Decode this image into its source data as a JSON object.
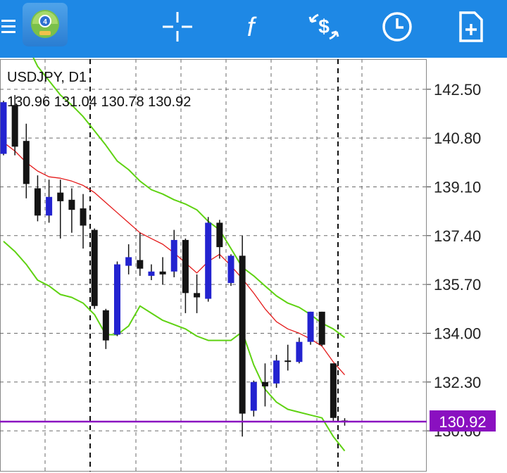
{
  "toolbar": {
    "icons": [
      "menu-icon",
      "app-logo",
      "crosshair-icon",
      "function-icon",
      "trade-icon",
      "clock-icon",
      "add-chart-icon"
    ]
  },
  "colors": {
    "toolbar_bg": "#1e88e5",
    "bull_candle": "#2323d0",
    "bear_candle": "#141414",
    "ma": "#e41a1a",
    "bands": "#5fd212",
    "price_line": "#8a10c0",
    "grid": "#6a6a6a"
  },
  "chart_data": {
    "type": "candlestick",
    "symbol": "USDJPY, D1",
    "ohlc_header": [
      "130.96",
      "131.04",
      "130.78",
      "130.92"
    ],
    "current_price": "130.92",
    "yticks": [
      "142.50",
      "140.80",
      "139.10",
      "137.40",
      "135.70",
      "134.00",
      "132.30",
      "130.60"
    ],
    "ylim": [
      129.18,
      143.55
    ],
    "candles": [
      {
        "o": 140.25,
        "h": 142.1,
        "l": 140.2,
        "c": 142.05
      },
      {
        "o": 141.95,
        "h": 142.3,
        "l": 140.2,
        "c": 140.5
      },
      {
        "o": 140.7,
        "h": 141.3,
        "l": 138.7,
        "c": 139.2
      },
      {
        "o": 139.05,
        "h": 139.5,
        "l": 137.9,
        "c": 138.1
      },
      {
        "o": 138.1,
        "h": 139.35,
        "l": 137.85,
        "c": 138.75
      },
      {
        "o": 138.9,
        "h": 139.35,
        "l": 137.3,
        "c": 138.6
      },
      {
        "o": 138.65,
        "h": 139.05,
        "l": 137.5,
        "c": 138.3
      },
      {
        "o": 138.35,
        "h": 138.85,
        "l": 136.95,
        "c": 137.75
      },
      {
        "o": 137.6,
        "h": 137.65,
        "l": 134.85,
        "c": 134.95
      },
      {
        "o": 134.8,
        "h": 134.85,
        "l": 133.45,
        "c": 133.75
      },
      {
        "o": 133.95,
        "h": 136.5,
        "l": 133.9,
        "c": 136.4
      },
      {
        "o": 136.35,
        "h": 137.1,
        "l": 136.05,
        "c": 136.65
      },
      {
        "o": 136.55,
        "h": 137.5,
        "l": 136.0,
        "c": 136.25
      },
      {
        "o": 136.0,
        "h": 136.4,
        "l": 135.85,
        "c": 136.15
      },
      {
        "o": 136.15,
        "h": 136.65,
        "l": 135.7,
        "c": 136.05
      },
      {
        "o": 136.15,
        "h": 137.6,
        "l": 135.95,
        "c": 137.25
      },
      {
        "o": 137.25,
        "h": 137.3,
        "l": 134.7,
        "c": 135.4
      },
      {
        "o": 135.4,
        "h": 136.05,
        "l": 134.7,
        "c": 135.25
      },
      {
        "o": 135.2,
        "h": 138.05,
        "l": 135.1,
        "c": 137.85
      },
      {
        "o": 137.85,
        "h": 137.95,
        "l": 136.6,
        "c": 137.0
      },
      {
        "o": 135.75,
        "h": 136.75,
        "l": 135.65,
        "c": 136.7
      },
      {
        "o": 136.7,
        "h": 137.4,
        "l": 130.4,
        "c": 131.2
      },
      {
        "o": 131.3,
        "h": 132.35,
        "l": 131.1,
        "c": 132.3
      },
      {
        "o": 132.3,
        "h": 132.95,
        "l": 131.45,
        "c": 132.15
      },
      {
        "o": 132.25,
        "h": 133.25,
        "l": 132.1,
        "c": 133.05
      },
      {
        "o": 133.05,
        "h": 133.6,
        "l": 132.7,
        "c": 133.0
      },
      {
        "o": 133.0,
        "h": 133.85,
        "l": 132.95,
        "c": 133.7
      },
      {
        "o": 133.7,
        "h": 134.75,
        "l": 133.6,
        "c": 134.75
      },
      {
        "o": 134.75,
        "h": 134.75,
        "l": 133.55,
        "c": 133.6
      },
      {
        "o": 132.95,
        "h": 132.95,
        "l": 130.95,
        "c": 131.05
      },
      {
        "o": 130.96,
        "h": 131.04,
        "l": 130.78,
        "c": 130.92
      }
    ],
    "ma": [
      140.65,
      140.35,
      139.95,
      139.65,
      139.45,
      139.4,
      139.3,
      139.15,
      138.9,
      138.55,
      138.2,
      137.85,
      137.5,
      137.3,
      137.1,
      136.8,
      136.45,
      136.1,
      136.5,
      136.75,
      136.35,
      135.9,
      135.4,
      134.85,
      134.4,
      134.15,
      134.0,
      133.8,
      133.55,
      133.0,
      132.55
    ],
    "upper_band": [
      145.2,
      144.6,
      144.1,
      143.3,
      142.8,
      142.3,
      141.95,
      141.55,
      141.05,
      140.55,
      140.0,
      139.7,
      139.3,
      139.0,
      138.85,
      138.65,
      138.5,
      138.3,
      137.9,
      137.6,
      136.95,
      136.3,
      136.0,
      135.65,
      135.3,
      135.05,
      134.9,
      134.65,
      134.35,
      134.15,
      133.85
    ],
    "lower_band": [
      137.2,
      136.85,
      136.4,
      135.85,
      135.65,
      135.35,
      135.25,
      135.05,
      134.65,
      133.95,
      133.95,
      134.25,
      134.95,
      134.7,
      134.45,
      134.3,
      134.15,
      133.9,
      133.75,
      133.75,
      133.75,
      134.05,
      132.9,
      132.05,
      131.6,
      131.35,
      131.25,
      131.15,
      131.05,
      130.4,
      129.9
    ]
  }
}
